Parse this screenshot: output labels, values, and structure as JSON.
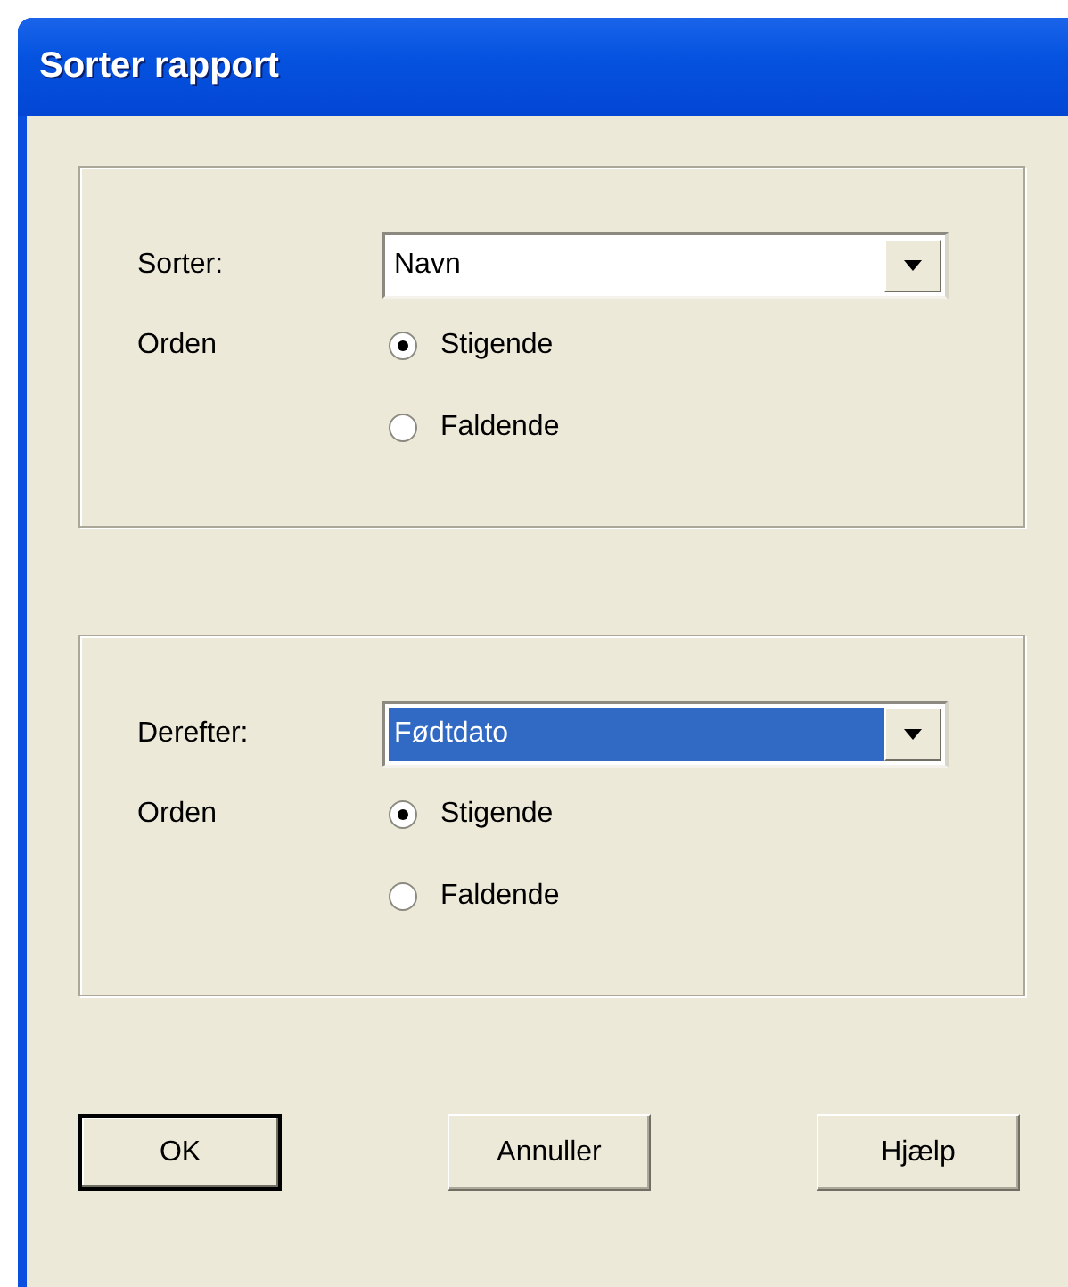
{
  "window": {
    "title": "Sorter rapport"
  },
  "groups": [
    {
      "label": "Sorter:",
      "combo": {
        "value": "Navn",
        "highlighted": false
      },
      "order_label": "Orden",
      "options": [
        {
          "label": "Stigende",
          "selected": true
        },
        {
          "label": "Faldende",
          "selected": false
        }
      ]
    },
    {
      "label": "Derefter:",
      "combo": {
        "value": "Fødtdato",
        "highlighted": true
      },
      "order_label": "Orden",
      "options": [
        {
          "label": "Stigende",
          "selected": true
        },
        {
          "label": "Faldende",
          "selected": false
        }
      ]
    }
  ],
  "buttons": [
    {
      "label": "OK",
      "default": true
    },
    {
      "label": "Annuller",
      "default": false
    },
    {
      "label": "Hjælp",
      "default": false
    }
  ]
}
